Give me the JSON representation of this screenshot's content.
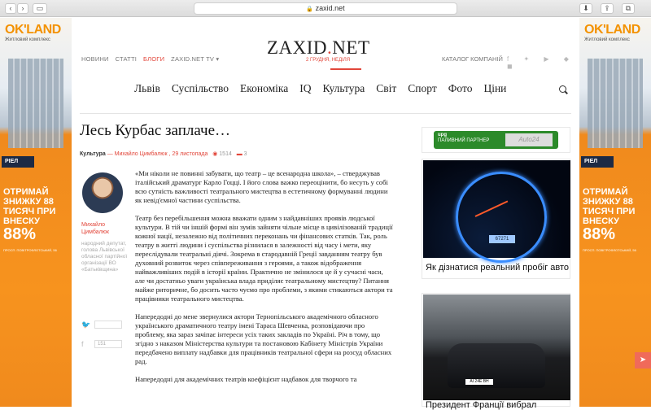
{
  "browser": {
    "url": "zaxid.net",
    "back": "‹",
    "forward": "›",
    "sidebar": "▭",
    "download": "⬇",
    "share": "⇪",
    "tabs": "⧉",
    "lock": "🔒"
  },
  "ad": {
    "logo": "OK'LAND",
    "sub": "Житловий комплекс",
    "badge": "РІЕЛ",
    "text": "ОТРИМАЙ ЗНИЖКУ 88 ТИСЯЧ ПРИ ВНЕСКУ",
    "big": "88%",
    "small": "ПРОСП. ПОВІТРОФЛОТСЬКИЙ, 56"
  },
  "site": {
    "logo_main": "ZAXID",
    "logo_dot": ".",
    "logo_end": "NET",
    "date": "2 ГРУДНЯ, НЕДІЛЯ",
    "topnav": [
      "НОВИНИ",
      "СТАТТІ",
      "БЛОГИ",
      "ZAXID.NET TV ▾"
    ],
    "catalog": "КАТАЛОГ КОМПАНІЙ",
    "mainnav": [
      "Львів",
      "Суспільство",
      "Економіка",
      "IQ",
      "Культура",
      "Світ",
      "Спорт",
      "Фото",
      "Ціни"
    ]
  },
  "article": {
    "title": "Лесь Курбас заплаче…",
    "category": "Культура",
    "author_line": "— Михайло Цимбалюк ,",
    "date": "29 листопада",
    "views": "1514",
    "comments": "3",
    "author_name": "Михайло Цимбалюк",
    "author_bio": "народний депутат, голова Львівської обласної партійної організації ВО «Батьківщина»",
    "twitter_count": "",
    "fb_count": "151",
    "paragraphs": [
      "«Ми ніколи не повинні забувати, що театр – це всенародна школа», – стверджував італійський драматург Карло Гоцці. І його слова важко переоцінити, бо несуть у собі всю сутність важливості театрального мистецтва в естетичному формуванні людини як невід'ємної частини суспільства.",
      "Театр без перебільшення можна вважати одним з найдавніших проявів людської культури. В тій чи іншій формі він зумів зайняти чільне місце в цивілізованій традиції кожної нації, незалежно від політичних переконань чи фінансових статків. Так, роль театру в житті людини і суспільства різнилася в залежності від часу і мети, яку переслідували театральні діячі. Зокрема в стародавній Греції завданням театру був духовний розвиток через співпереживання з героями, а також відображення найважливіших подій в історії країни. Практично не змінилося це й у сучасні часи, але чи достатньо уваги українська влада приділяє театральному мистецтву? Питання майже риторичне, бо досить часто чуємо про проблеми, з якими стикаються актори та працівники театрального мистецтва.",
      "Напередодні до мене звернулися актори Тернопільського академічного обласного українського драматичного театру імені Тараса Шевченка, розповідаючи про проблему, яка зараз зачіпає інтереси усіх таких закладів по Україні. Річ в тому, що згідно з наказом Міністерства культури та постановою Кабінету Міністрів України передбачено виплату надбавки для працівників театральної сфери на розсуд обласних рад.",
      "Напередодні для академічних театрів коефіцієнт надбавок для творчого та"
    ]
  },
  "sidebar": {
    "ad_brand": "upg",
    "ad_sub": "ПАЛИВНИЙ ПАРТНЕР",
    "ad_right": "Auto24",
    "odo": "67271",
    "card1_title": "Як дізнатися реальний пробіг авто",
    "plate": "AI 24E BH",
    "card2_title": "Президент Франції вибрал"
  }
}
